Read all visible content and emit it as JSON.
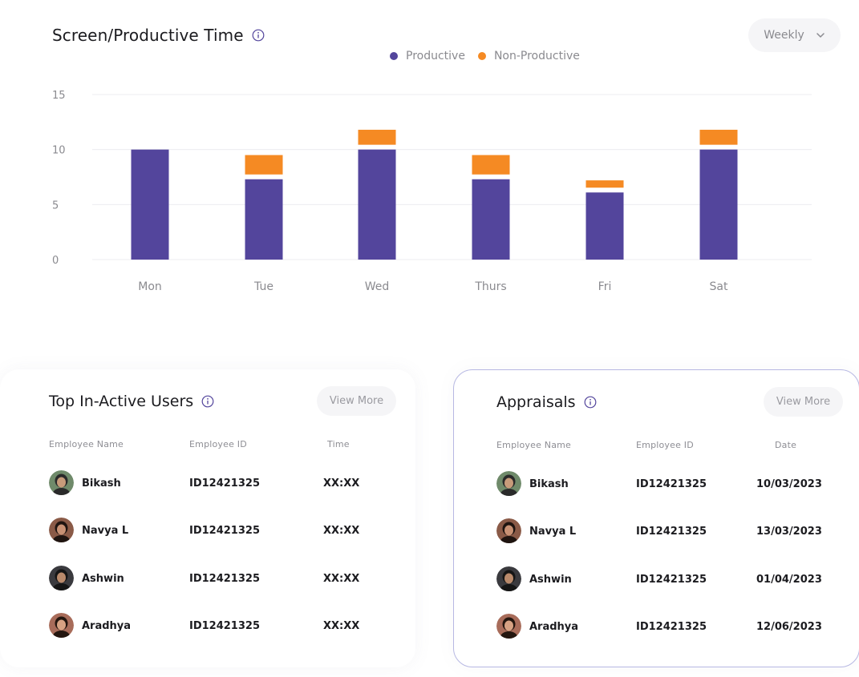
{
  "header": {
    "title": "Screen/Productive Time",
    "period": "Weekly"
  },
  "legend": {
    "productive": "Productive",
    "non_productive": "Non-Productive"
  },
  "colors": {
    "productive": "#53459c",
    "non_productive": "#f58a23",
    "accent_border": "#b7b8e3"
  },
  "chart_data": {
    "type": "bar",
    "stacked": true,
    "categories": [
      "Mon",
      "Tue",
      "Wed",
      "Thurs",
      "Fri",
      "Sat"
    ],
    "series": [
      {
        "name": "Productive",
        "values": [
          10,
          7.3,
          10,
          7.3,
          6.1,
          10
        ]
      },
      {
        "name": "Non-Productive",
        "values": [
          0,
          2.2,
          1.8,
          2.2,
          1.1,
          1.8
        ]
      }
    ],
    "yticks": [
      "15",
      "10",
      "5",
      "0"
    ],
    "ylim": [
      0,
      15
    ],
    "grid": true,
    "legend_position": "top-center"
  },
  "inactive": {
    "title": "Top In-Active Users",
    "view_more": "View More",
    "columns": [
      "Employee Name",
      "Employee ID",
      "Time"
    ],
    "rows": [
      {
        "name": "Bikash",
        "id": "ID12421325",
        "value": "XX:XX"
      },
      {
        "name": "Navya L",
        "id": "ID12421325",
        "value": "XX:XX"
      },
      {
        "name": "Ashwin",
        "id": "ID12421325",
        "value": "XX:XX"
      },
      {
        "name": "Aradhya",
        "id": "ID12421325",
        "value": "XX:XX"
      }
    ]
  },
  "appraisals": {
    "title": "Appraisals",
    "view_more": "View More",
    "columns": [
      "Employee Name",
      "Employee ID",
      "Date"
    ],
    "rows": [
      {
        "name": "Bikash",
        "id": "ID12421325",
        "value": "10/03/2023"
      },
      {
        "name": "Navya L",
        "id": "ID12421325",
        "value": "13/03/2023"
      },
      {
        "name": "Ashwin",
        "id": "ID12421325",
        "value": "01/04/2023"
      },
      {
        "name": "Aradhya",
        "id": "ID12421325",
        "value": "12/06/2023"
      }
    ]
  }
}
